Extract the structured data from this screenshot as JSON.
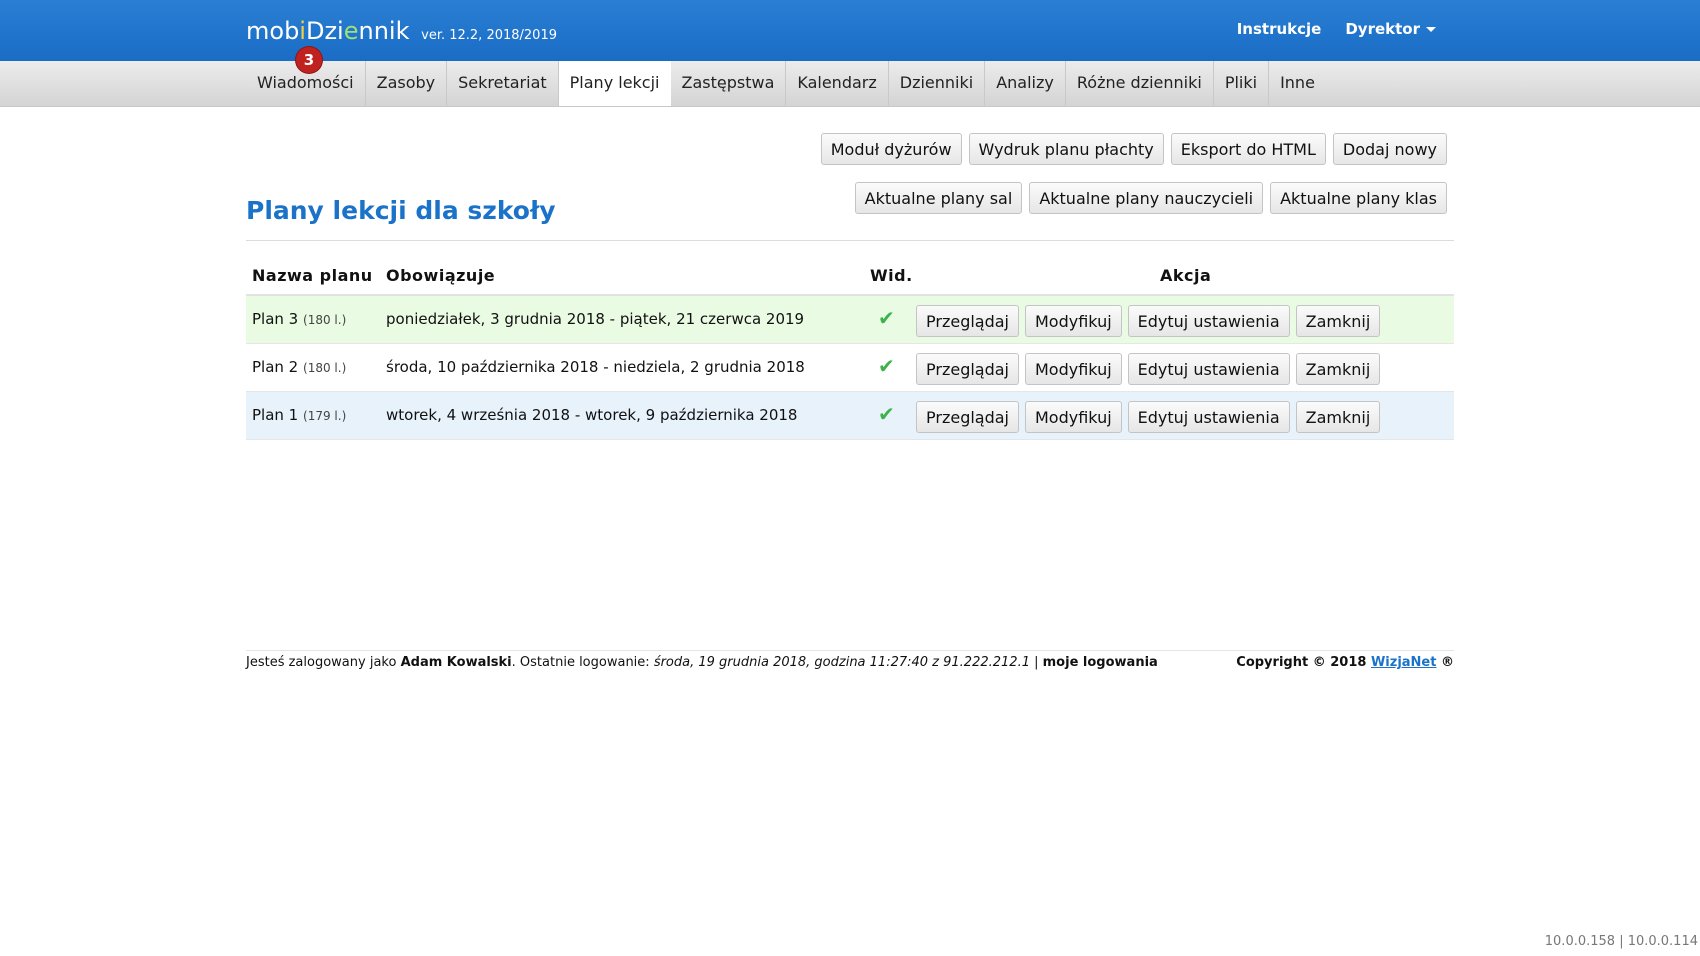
{
  "app": {
    "logo_pre": "mob",
    "logo_i": "i",
    "logo_mid": "Dzi",
    "logo_e": "e",
    "logo_post": "nnik",
    "version": "ver. 12.2, 2018/2019",
    "messages_badge": "3"
  },
  "topnav": {
    "instructions": "Instrukcje",
    "user_role": "Dyrektor"
  },
  "nav": {
    "tabs": [
      {
        "label": "Wiadomości"
      },
      {
        "label": "Zasoby"
      },
      {
        "label": "Sekretariat"
      },
      {
        "label": "Plany lekcji",
        "active": true
      },
      {
        "label": "Zastępstwa"
      },
      {
        "label": "Kalendarz"
      },
      {
        "label": "Dzienniki"
      },
      {
        "label": "Analizy"
      },
      {
        "label": "Różne dzienniki"
      },
      {
        "label": "Pliki"
      },
      {
        "label": "Inne"
      }
    ]
  },
  "toolbar": {
    "row1": [
      "Moduł dyżurów",
      "Wydruk planu płachty",
      "Eksport do HTML",
      "Dodaj nowy"
    ],
    "row2": [
      "Aktualne plany sal",
      "Aktualne plany nauczycieli",
      "Aktualne plany klas"
    ]
  },
  "page": {
    "title": "Plany lekcji dla szkoły"
  },
  "table": {
    "headers": {
      "name": "Nazwa planu",
      "period": "Obowiązuje",
      "visible": "Wid.",
      "action": "Akcja"
    },
    "action_labels": {
      "view": "Przeglądaj",
      "modify": "Modyfikuj",
      "settings": "Edytuj ustawienia",
      "close": "Zamknij"
    },
    "rows": [
      {
        "name": "Plan 3",
        "count": "(180 l.)",
        "period": "poniedziałek, 3 grudnia 2018 - piątek, 21 czerwca 2019",
        "visible": "✔"
      },
      {
        "name": "Plan 2",
        "count": "(180 l.)",
        "period": "środa, 10 października 2018 - niedziela, 2 grudnia 2018",
        "visible": "✔"
      },
      {
        "name": "Plan 1",
        "count": "(179 l.)",
        "period": "wtorek, 4 września 2018 - wtorek, 9 października 2018",
        "visible": "✔"
      }
    ]
  },
  "footer": {
    "logged_as_prefix": "Jesteś zalogowany jako",
    "user": "Adam Kowalski",
    "last_login_prefix": ". Ostatnie logowanie:",
    "last_login": "środa, 19 grudnia 2018, godzina 11:27:40 z 91.222.212.1",
    "separator": "|",
    "my_logins": "moje logowania",
    "copyright": "Copyright © 2018",
    "company": "WizjaNet",
    "reg": "®"
  },
  "ipinfo": "10.0.0.158 | 10.0.0.114",
  "colors": {
    "header_blue": "#1a6cc4",
    "title_blue": "#1a73c9",
    "badge_red": "#c0221f",
    "check_green": "#3cb34a"
  }
}
